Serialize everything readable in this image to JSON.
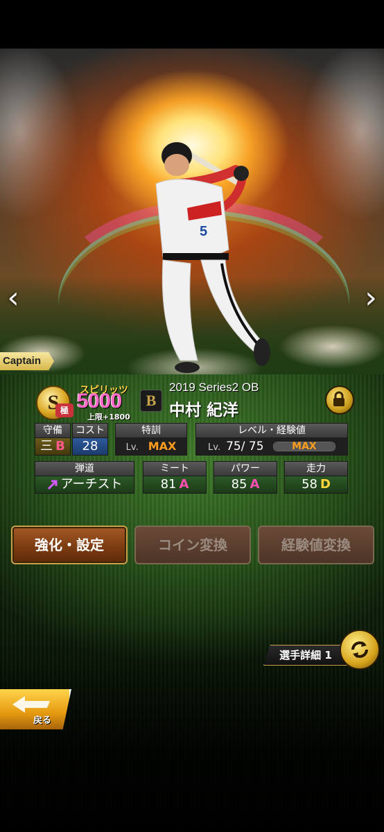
{
  "card": {
    "captain_label": "Captain",
    "rank_letter": "S",
    "rank_sub": "極",
    "spirits_label": "スピリッツ",
    "spirits_value": "5000",
    "spirits_limit": "上限+1800",
    "team_logo": "B",
    "series": "2019 Series2 OB",
    "player_name": "中村 紀洋"
  },
  "stats": {
    "position": {
      "header": "守備",
      "value": "三",
      "grade": "B"
    },
    "cost": {
      "header": "コスト",
      "value": "28"
    },
    "training": {
      "header": "特訓",
      "lv_label": "Lv.",
      "value": "MAX"
    },
    "level": {
      "header": "レベル・経験値",
      "lv_label": "Lv.",
      "current": "75",
      "separator": "/",
      "max_level": "75",
      "exp_label": "MAX",
      "exp_progress": 1.0
    },
    "trajectory": {
      "header": "弾道",
      "value": "アーチスト"
    },
    "contact": {
      "header": "ミート",
      "value": "81",
      "grade": "A"
    },
    "power": {
      "header": "パワー",
      "value": "85",
      "grade": "A"
    },
    "speed": {
      "header": "走力",
      "value": "58",
      "grade": "D"
    }
  },
  "actions": {
    "enhance": "強化・設定",
    "coin": "コイン変換",
    "exp": "経験値変換"
  },
  "detail": {
    "label": "選手詳細 1"
  },
  "back": {
    "label": "戻る"
  },
  "icons": {
    "prev": "chevron-left-icon",
    "next": "chevron-right-icon",
    "lock": "lock-icon",
    "swap": "swap-icon",
    "back": "back-arrow-icon"
  }
}
